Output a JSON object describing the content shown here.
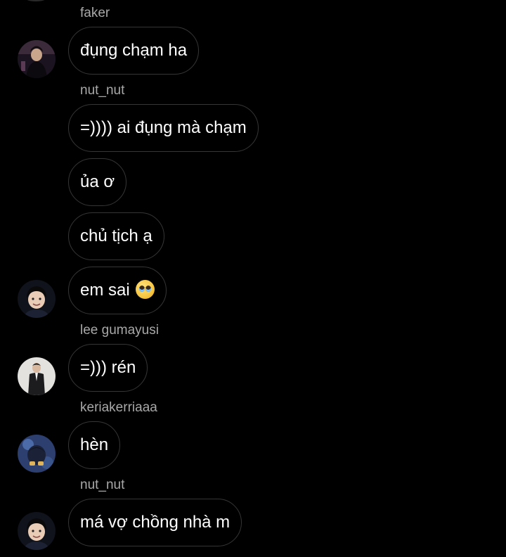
{
  "messages": [
    {
      "sender": "faker",
      "text": "đụng chạm ha",
      "avatar": "avatar-faker"
    },
    {
      "sender": "nut_nut",
      "text": "=)))) ai đụng mà chạm"
    },
    {
      "text": "ủa ơ"
    },
    {
      "text": "chủ tịch ạ"
    },
    {
      "text": "em sai",
      "emoji": "pleading-face-emoji",
      "avatar": "avatar-nut-nut"
    },
    {
      "sender": "lee gumayusi",
      "text": "=))) rén",
      "avatar": "avatar-gumayusi"
    },
    {
      "sender": "keriakerriaaa",
      "text": "hèn",
      "avatar": "avatar-keria"
    },
    {
      "sender": "nut_nut",
      "text": "má vợ chồng nhà m",
      "avatar": "avatar-nut-nut"
    }
  ],
  "colors": {
    "background": "#000000",
    "bubble_border": "#363636",
    "sender_name": "#a8a8a8",
    "text": "#ffffff"
  }
}
